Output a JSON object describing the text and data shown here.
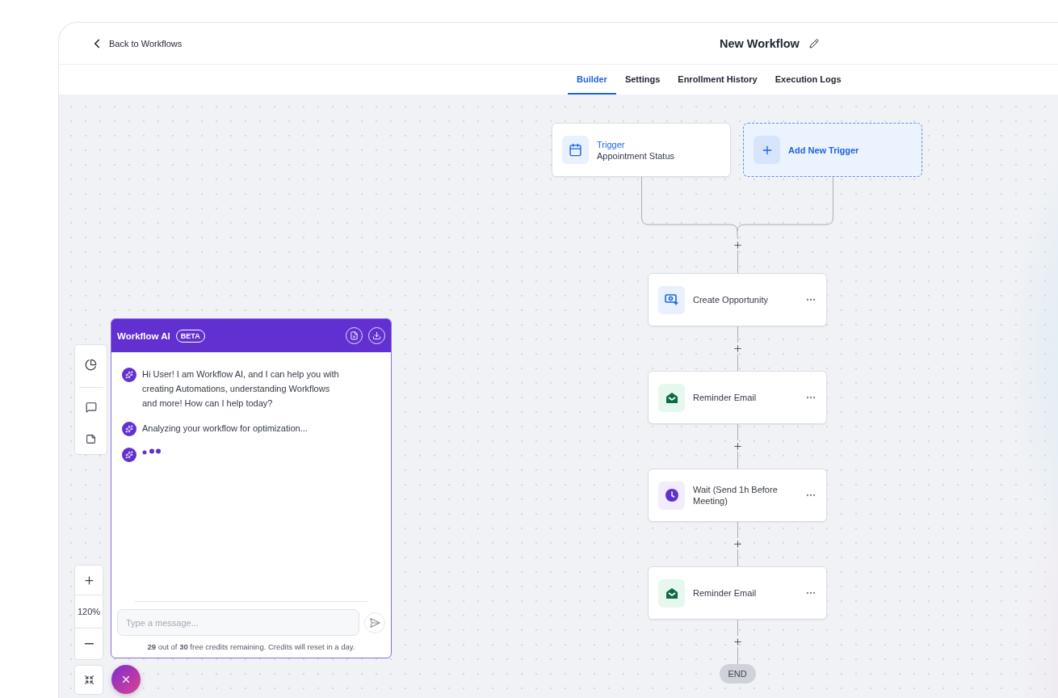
{
  "header": {
    "back_link": "Back to Workflows",
    "title": "New Workflow"
  },
  "tabs": [
    {
      "label": "Builder",
      "selected": true
    },
    {
      "label": "Settings",
      "selected": false
    },
    {
      "label": "Enrollment History",
      "selected": false
    },
    {
      "label": "Execution Logs",
      "selected": false
    }
  ],
  "triggers": [
    {
      "kind": "trigger",
      "title": "Trigger",
      "subtitle": "Appointment Status"
    },
    {
      "kind": "add",
      "title": "Add New Trigger"
    }
  ],
  "actions": [
    {
      "kind": "opportunity",
      "label": "Create Opportunity"
    },
    {
      "kind": "email",
      "label": "Reminder Email"
    },
    {
      "kind": "wait",
      "label": "Wait (Send 1h Before Meeting)"
    },
    {
      "kind": "email",
      "label": "Reminder Email"
    }
  ],
  "end_label": "END",
  "zoom_text": "120%",
  "chat": {
    "title": "Workflow AI",
    "badge": "BETA",
    "messages": [
      {
        "kind": "text",
        "text": "Hi User! I am Workflow AI, and I can help you with creating Automations, understanding Workflows and more! How can I help today?"
      },
      {
        "kind": "text",
        "text": "Analyzing your workflow for optimization..."
      },
      {
        "kind": "typing"
      }
    ],
    "input": {
      "placeholder": "Type a message..."
    },
    "credits_note": "**29** out of **30** free credits remaining. Credits will reset in a day."
  }
}
